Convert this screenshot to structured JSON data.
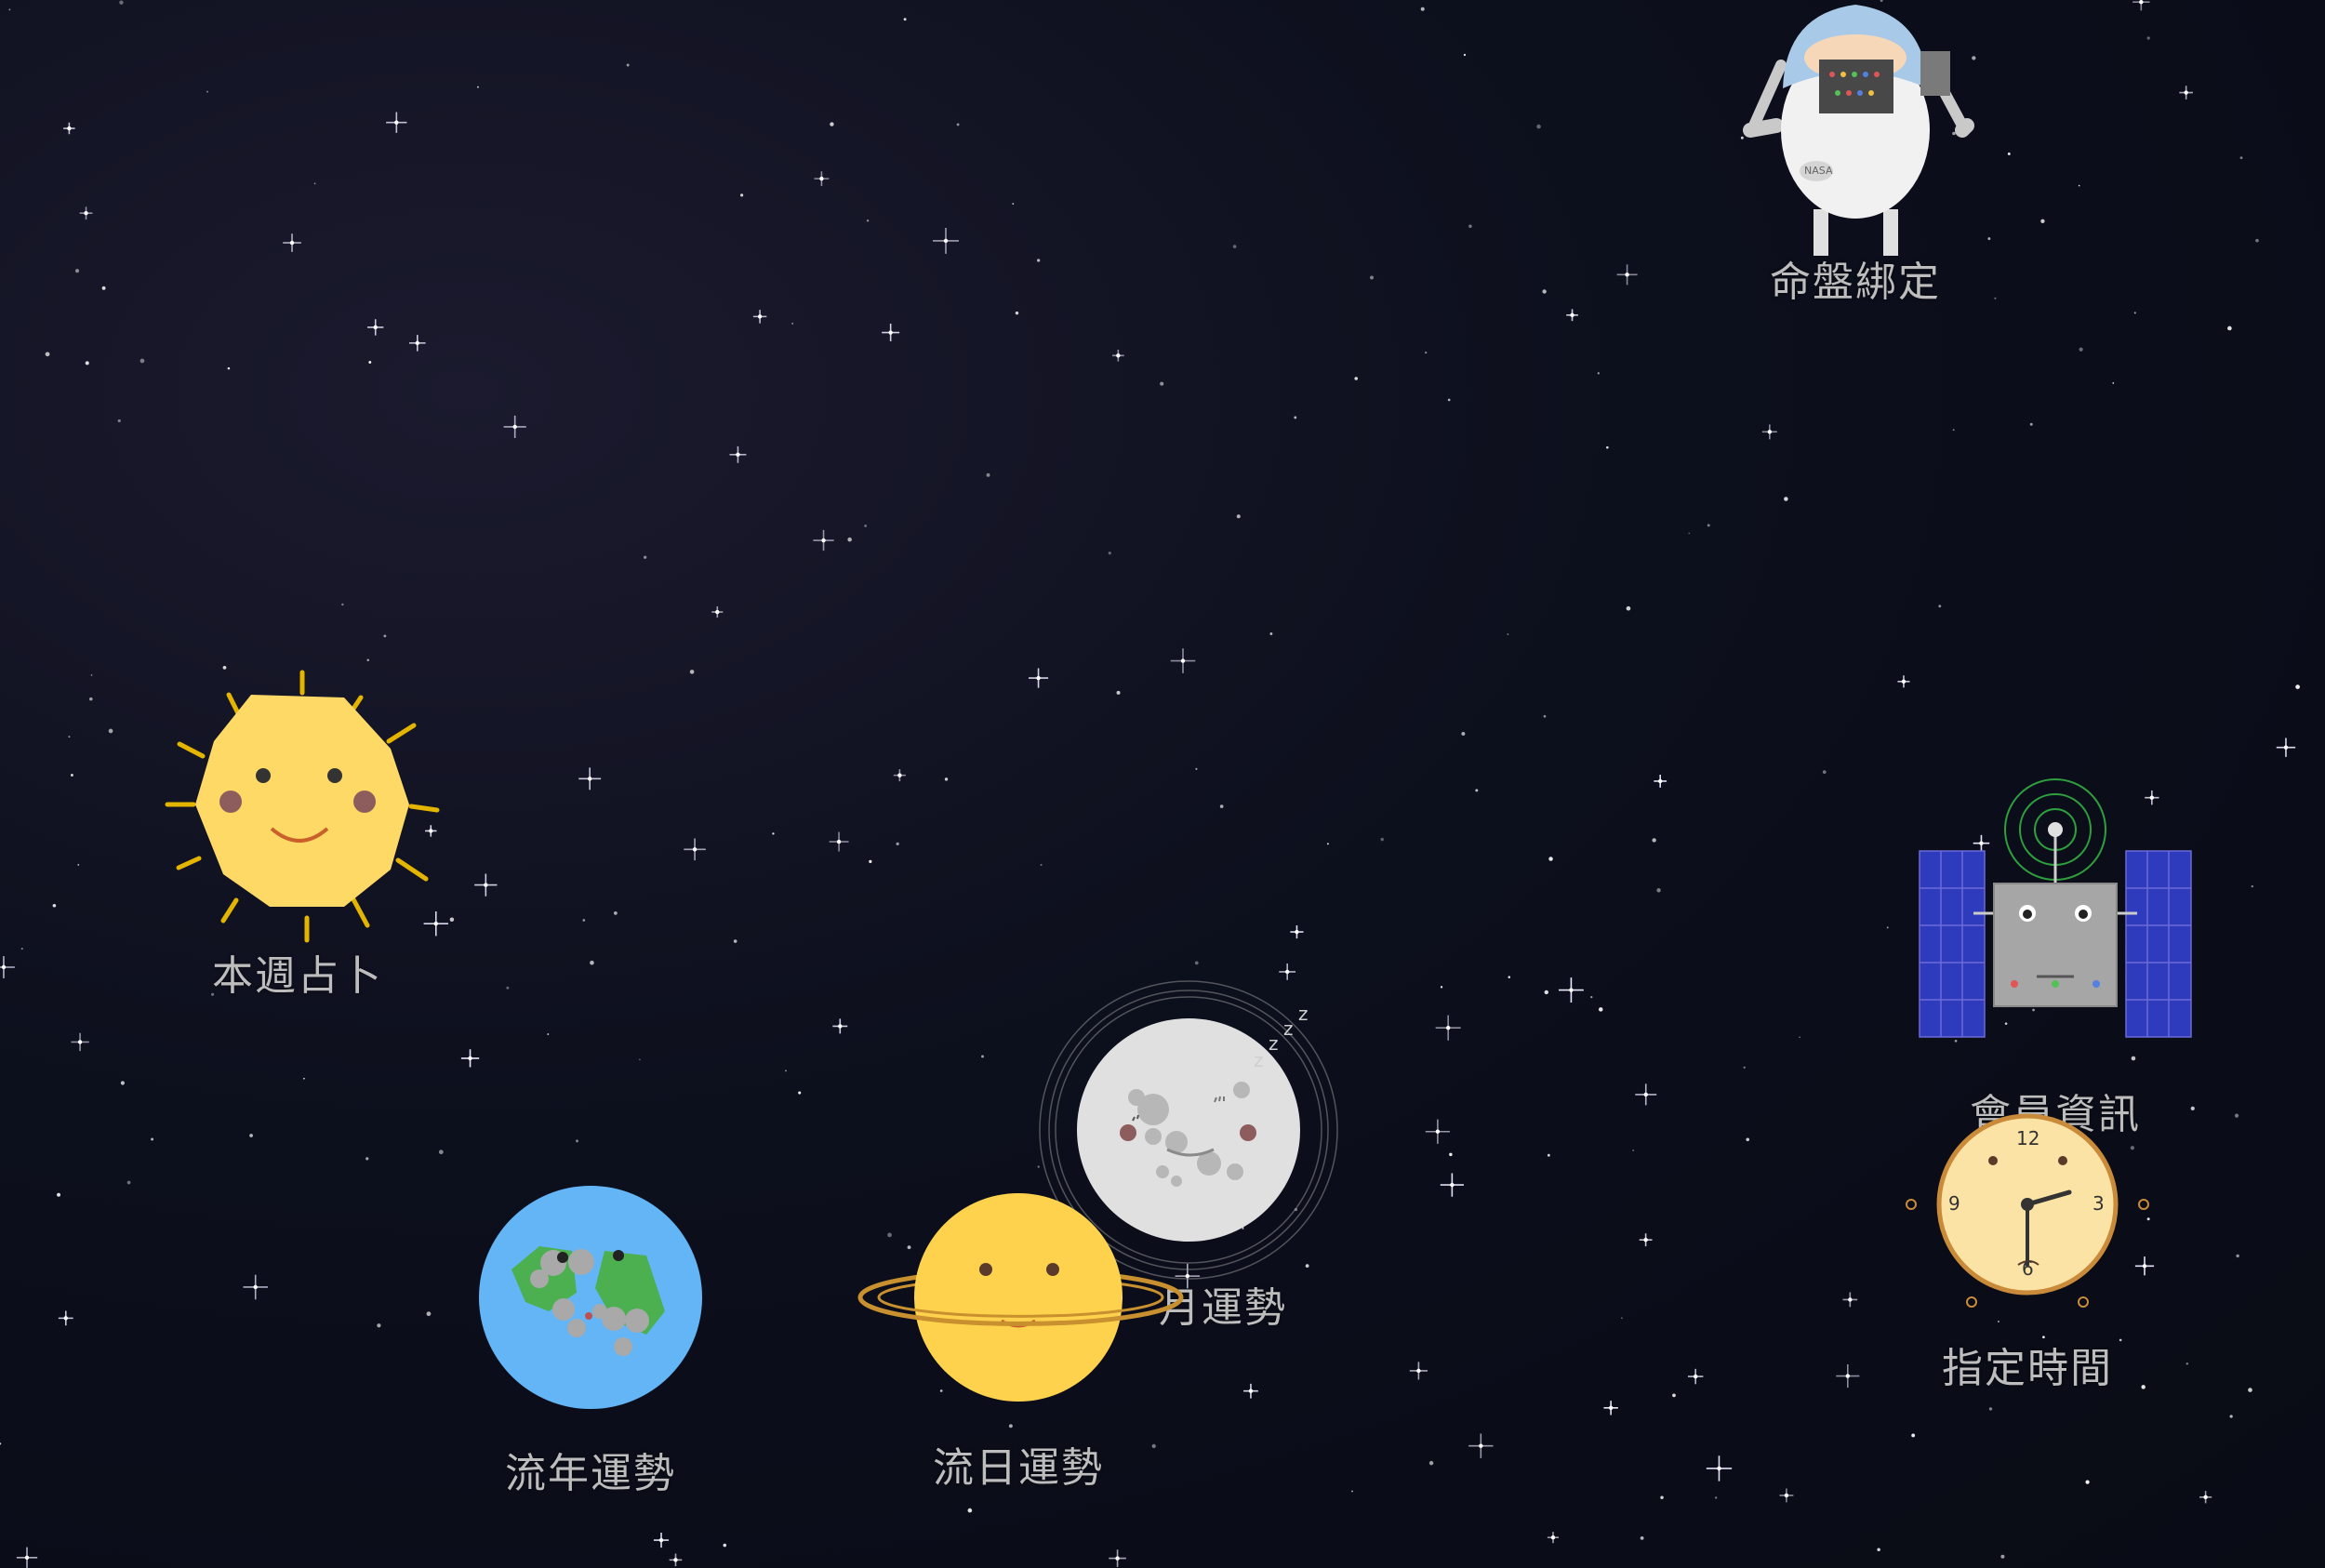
{
  "menu": {
    "weekly_divination": {
      "label": "本週占卜",
      "icon": "sun-icon"
    },
    "annual_fortune": {
      "label": "流年運勢",
      "icon": "earth-icon"
    },
    "daily_fortune": {
      "label": "流日運勢",
      "icon": "saturn-icon"
    },
    "monthly_fortune": {
      "label": "月運勢",
      "visible_label": "流月運勢",
      "icon": "moon-icon"
    },
    "chart_binding": {
      "label": "命盤綁定",
      "icon": "astronaut-icon",
      "badge": "NASA"
    },
    "member_info": {
      "label": "會員資訊",
      "icon": "satellite-icon"
    },
    "specified_time": {
      "label": "指定時間",
      "icon": "clock-icon",
      "clock_numbers": [
        "12",
        "3",
        "6",
        "9"
      ]
    }
  },
  "moon": {
    "sleep_text": [
      "z",
      "z",
      "z",
      "z"
    ]
  },
  "colors": {
    "sky": "#090b15",
    "label": "#bdbdbd",
    "sun": "#ffd966",
    "earth_ocean": "#64b5f6",
    "earth_land": "#4caf50",
    "saturn": "#ffd24d",
    "saturn_ring": "#c8902e",
    "moon": "#e0e0e0",
    "satellite_panel": "#3f3fb5",
    "clock_face": "#fbe3a6"
  }
}
